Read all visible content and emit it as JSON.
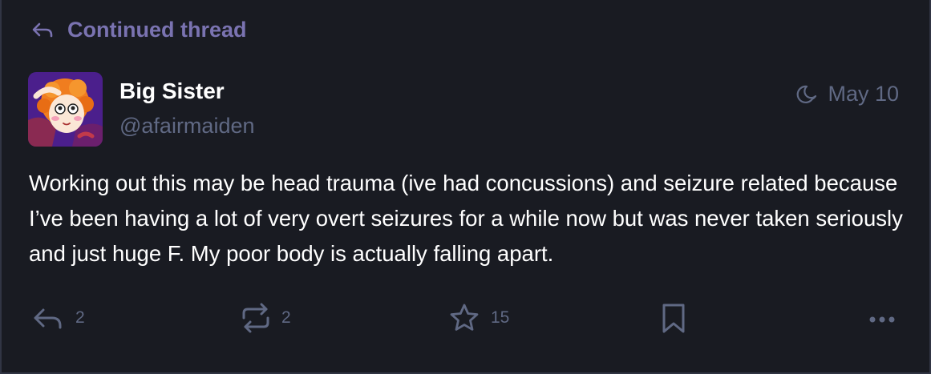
{
  "prepend": {
    "icon": "reply-icon",
    "label": "Continued thread"
  },
  "account": {
    "display_name": "Big Sister",
    "handle": "@afairmaiden",
    "avatar": "cartoon-avatar"
  },
  "status": {
    "visibility_icon": "moon-icon",
    "date": "May 10",
    "content": "Working out this may be head trauma (ive had concussions) and seizure related because I’ve been having a lot of very overt seizures for a while now but was never taken seriously and just huge F. My poor body is actually falling apart."
  },
  "actions": {
    "reply": {
      "icon": "reply-icon",
      "count": "2"
    },
    "boost": {
      "icon": "boost-icon",
      "count": "2"
    },
    "favourite": {
      "icon": "star-icon",
      "count": "15"
    },
    "bookmark": {
      "icon": "bookmark-icon"
    },
    "more": {
      "icon": "more-icon"
    }
  },
  "colors": {
    "background": "#191b22",
    "accent": "#7a73b1",
    "muted": "#606984",
    "text": "#ffffff"
  }
}
